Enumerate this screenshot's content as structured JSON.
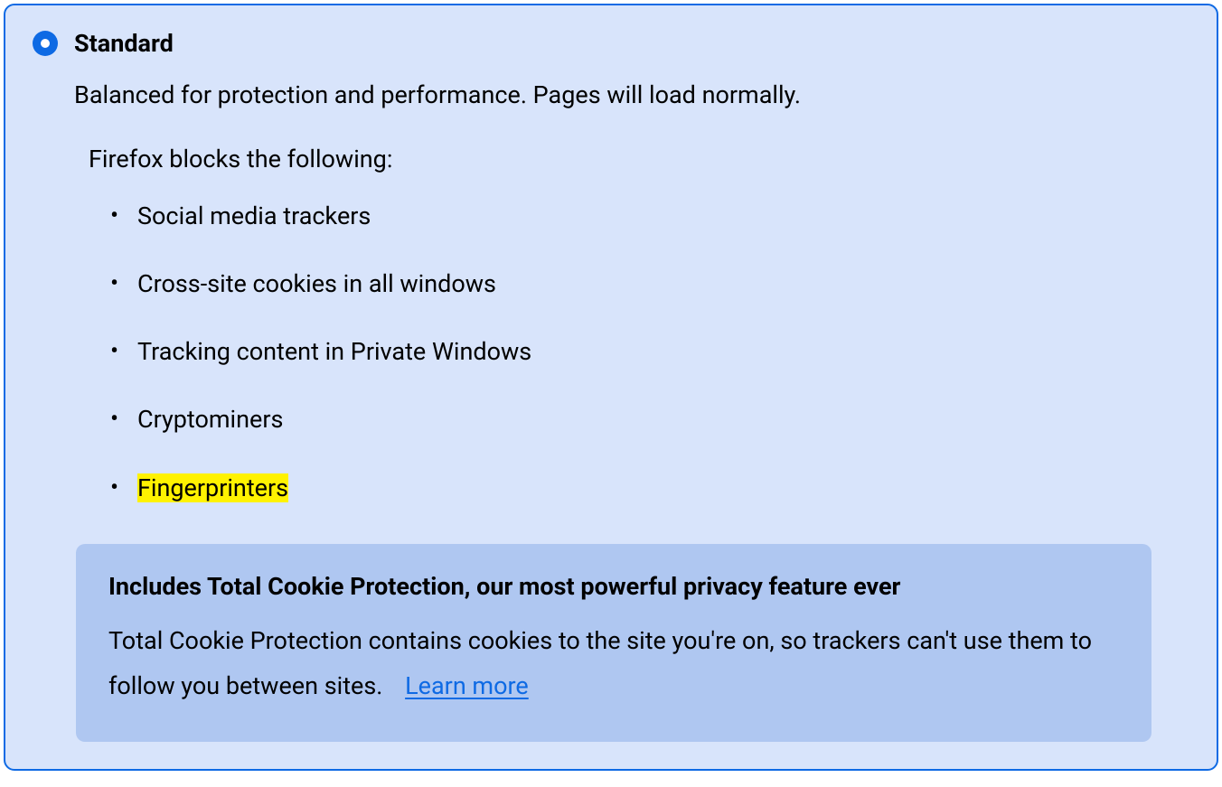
{
  "protection": {
    "mode": {
      "title": "Standard",
      "selected": true,
      "description": "Balanced for protection and performance. Pages will load normally."
    },
    "blocks": {
      "heading": "Firefox blocks the following:",
      "items": [
        {
          "label": "Social media trackers",
          "highlighted": false
        },
        {
          "label": "Cross-site cookies in all windows",
          "highlighted": false
        },
        {
          "label": "Tracking content in Private Windows",
          "highlighted": false
        },
        {
          "label": "Cryptominers",
          "highlighted": false
        },
        {
          "label": "Fingerprinters",
          "highlighted": true
        }
      ]
    },
    "infobox": {
      "title": "Includes Total Cookie Protection, our most powerful privacy feature ever",
      "description": "Total Cookie Protection contains cookies to the site you're on, so trackers can't use them to follow you between sites.",
      "learn_more_label": "Learn more"
    }
  },
  "colors": {
    "card_bg": "#D8E4FB",
    "card_border": "#0E6AE4",
    "infobox_bg": "#AFC7F1",
    "highlight_bg": "#FFF200",
    "link": "#0E6AE4"
  }
}
